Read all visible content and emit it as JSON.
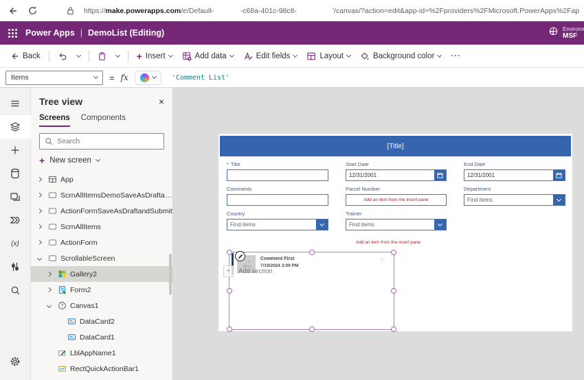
{
  "browser": {
    "url_scheme": "https://",
    "url_host": "make.powerapps.com",
    "url_path": "/e/Default-",
    "url_redacted": "-c68a-401c-98c8-",
    "url_query": "'/canvas/?action=edit&app-id=%2Fproviders%2FMicrosoft.PowerApps%2Fap"
  },
  "app_header": {
    "product": "Power Apps",
    "divider": "|",
    "app_title": "DemoList (Editing)",
    "environment_label": "Environment",
    "environment_name": "MSF"
  },
  "toolbar": {
    "back": "Back",
    "insert": "Insert",
    "add_data": "Add data",
    "edit_fields": "Edit fields",
    "layout": "Layout",
    "background_color": "Background color",
    "more": "···"
  },
  "formula_bar": {
    "property": "Items",
    "equals": "=",
    "fx": "fx",
    "formula": "'Comment List'"
  },
  "tree_panel": {
    "title": "Tree view",
    "close": "×",
    "tabs": {
      "screens": "Screens",
      "components": "Components"
    },
    "search_placeholder": "Search",
    "new_screen": "New screen",
    "items": [
      {
        "label": "App",
        "icon": "app",
        "level": 0,
        "chevron": "right",
        "selected": false
      },
      {
        "label": "ScrnAllItemsDemoSaveAsDraftandSubmit",
        "icon": "screen",
        "level": 0,
        "chevron": "right",
        "selected": false
      },
      {
        "label": "ActionFormSaveAsDraftandSubmit",
        "icon": "screen",
        "level": 0,
        "chevron": "right",
        "selected": false
      },
      {
        "label": "ScrnAllItems",
        "icon": "screen",
        "level": 0,
        "chevron": "right",
        "selected": false
      },
      {
        "label": "ActionForm",
        "icon": "screen",
        "level": 0,
        "chevron": "right",
        "selected": false
      },
      {
        "label": "ScrollableScreen",
        "icon": "screen",
        "level": 0,
        "chevron": "down",
        "selected": false
      },
      {
        "label": "Gallery2",
        "icon": "gallery",
        "level": 1,
        "chevron": "right",
        "selected": true
      },
      {
        "label": "Form2",
        "icon": "form",
        "level": 1,
        "chevron": "right",
        "selected": false
      },
      {
        "label": "Canvas1",
        "icon": "canvas",
        "level": 1,
        "chevron": "down",
        "selected": false
      },
      {
        "label": "DataCard2",
        "icon": "datacard",
        "level": 2,
        "chevron": "none",
        "selected": false
      },
      {
        "label": "DataCard1",
        "icon": "datacard",
        "level": 2,
        "chevron": "none",
        "selected": false
      },
      {
        "label": "LblAppName1",
        "icon": "label",
        "level": 1,
        "chevron": "none",
        "selected": false
      },
      {
        "label": "RectQuickActionBar1",
        "icon": "rect",
        "level": 1,
        "chevron": "none",
        "selected": false
      }
    ]
  },
  "canvas": {
    "screen_title": "[Title]",
    "required_marker": "*",
    "fields": [
      {
        "label": "Title",
        "type": "text",
        "value": ""
      },
      {
        "label": "Start Date",
        "type": "date",
        "value": "12/31/2001"
      },
      {
        "label": "End Date",
        "type": "date",
        "value": "12/31/2001"
      },
      {
        "label": "Comments",
        "type": "text",
        "value": ""
      },
      {
        "label": "Parcel Number",
        "type": "placeholder",
        "value": "Add an item from the insert pane"
      },
      {
        "label": "Department",
        "type": "combo",
        "value": "Find items"
      },
      {
        "label": "Country",
        "type": "combo",
        "value": "Find items"
      },
      {
        "label": "Trainer",
        "type": "combo",
        "value": "Find items"
      }
    ],
    "insert_hint": "Add an item from the insert pane",
    "gallery": {
      "item_title": "Comment First",
      "item_timestamp": "7/19/2024 3:09 PM",
      "chevron": "›"
    },
    "add_section": "Add section",
    "add_section_plus": "+"
  },
  "colors": {
    "brand_purple": "#742774",
    "form_blue": "#3565ae",
    "error_red": "#a4262c",
    "selection_purple": "#a864a8",
    "formula_teal": "#038387"
  }
}
